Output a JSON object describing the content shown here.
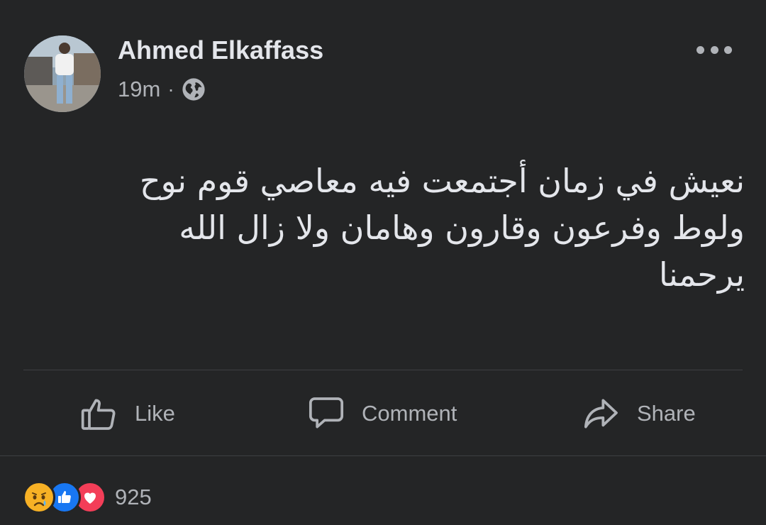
{
  "post": {
    "author": "Ahmed Elkaffass",
    "time": "19m",
    "separator": "·",
    "privacy_icon": "globe-icon",
    "text_lines": [
      "نعيش في زمان أجتمعت فيه معاصي قوم نوح",
      "ولوط وفرعون وقارون وهامان ولا زال الله",
      "يرحمنا"
    ]
  },
  "actions": {
    "like": "Like",
    "comment": "Comment",
    "share": "Share"
  },
  "reactions": {
    "icons": [
      "sad-emoji-icon",
      "like-icon",
      "love-icon"
    ],
    "count": "925"
  },
  "colors": {
    "background": "#242526",
    "primary_text": "#e4e6eb",
    "secondary_text": "#b0b3b8",
    "divider": "#3e4042",
    "like_blue": "#1877f2",
    "love_red": "#f33e58",
    "sad_yellow": "#f7b125"
  }
}
